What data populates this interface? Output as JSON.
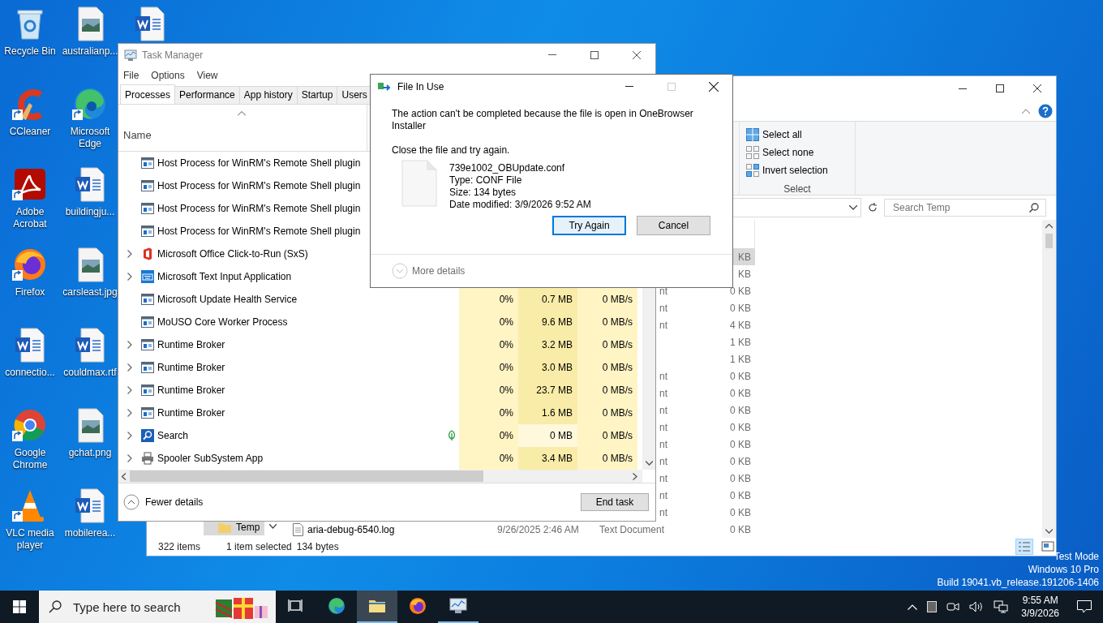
{
  "desktop": {
    "icons": [
      {
        "label": "Recycle Bin",
        "kind": "recycle",
        "shortcut": false
      },
      {
        "label": "CCleaner",
        "kind": "ccleaner",
        "shortcut": true
      },
      {
        "label": "Adobe Acrobat",
        "kind": "acrobat",
        "shortcut": true
      },
      {
        "label": "Firefox",
        "kind": "firefox",
        "shortcut": true
      },
      {
        "label": "connectio...",
        "kind": "word",
        "shortcut": false
      },
      {
        "label": "Google Chrome",
        "kind": "chrome",
        "shortcut": true
      },
      {
        "label": "VLC media player",
        "kind": "vlc",
        "shortcut": true
      },
      {
        "label": "australianp...",
        "kind": "image",
        "shortcut": false
      },
      {
        "label": "Microsoft Edge",
        "kind": "edge",
        "shortcut": true
      },
      {
        "label": "buildingju...",
        "kind": "word",
        "shortcut": false
      },
      {
        "label": "carsleast.jpg",
        "kind": "image",
        "shortcut": false
      },
      {
        "label": "couldmax.rtf",
        "kind": "word",
        "shortcut": false
      },
      {
        "label": "gchat.png",
        "kind": "image",
        "shortcut": false
      },
      {
        "label": "mobilerea...",
        "kind": "word",
        "shortcut": false
      },
      {
        "kind": "word",
        "shortcut": false
      }
    ]
  },
  "watermark": [
    "Test Mode",
    "Windows 10 Pro",
    "Build 19041.vb_release.191206-1406"
  ],
  "explorer": {
    "select_items": [
      {
        "label": "Select all",
        "kind": "all"
      },
      {
        "label": "Select none",
        "kind": "none"
      },
      {
        "label": "Invert selection",
        "kind": "invert"
      }
    ],
    "group_label": "Select",
    "search": {
      "placeholder": "Search Temp"
    },
    "nav_item": {
      "label": "Temp",
      "selected": true
    },
    "rows": [
      {
        "size": "KB",
        "selected": true
      },
      {
        "size": "KB",
        "selected": false
      },
      {
        "type": "nt",
        "size": "0 KB",
        "selected": false
      },
      {
        "type": "nt",
        "size": "0 KB",
        "selected": false
      },
      {
        "type": "nt",
        "size": "4 KB",
        "selected": false
      },
      {
        "size": "1 KB",
        "selected": false
      },
      {
        "size": "1 KB",
        "selected": false
      },
      {
        "type": "nt",
        "size": "0 KB",
        "selected": false
      },
      {
        "type": "nt",
        "size": "0 KB",
        "selected": false
      },
      {
        "type": "nt",
        "size": "0 KB",
        "selected": false
      },
      {
        "type": "nt",
        "size": "0 KB",
        "selected": false
      },
      {
        "type": "nt",
        "size": "0 KB",
        "selected": false
      },
      {
        "type": "nt",
        "size": "0 KB",
        "selected": false
      },
      {
        "type": "nt",
        "size": "0 KB",
        "selected": false
      },
      {
        "type": "nt",
        "size": "0 KB",
        "selected": false
      },
      {
        "type": "nt",
        "size": "0 KB",
        "selected": false
      },
      {
        "name": "aria-debug-6540.log",
        "date": "9/26/2025 2:46 AM",
        "type": "Text Document",
        "size": "0 KB",
        "selected": false
      }
    ],
    "status": {
      "count": "322 items",
      "selection": "1 item selected",
      "size": "134 bytes"
    }
  },
  "task_manager": {
    "title": "Task Manager",
    "menu": [
      "File",
      "Options",
      "View"
    ],
    "tabs": [
      {
        "label": "Processes",
        "selected": true
      },
      {
        "label": "Performance",
        "selected": false
      },
      {
        "label": "App history",
        "selected": false
      },
      {
        "label": "Startup",
        "selected": false
      },
      {
        "label": "Users",
        "selected": false
      }
    ],
    "column_name": "Name",
    "processes": [
      {
        "name": "Host Process for WinRM's Remote Shell plugin",
        "kind": "window",
        "expandable": false
      },
      {
        "name": "Host Process for WinRM's Remote Shell plugin",
        "kind": "window",
        "expandable": false
      },
      {
        "name": "Host Process for WinRM's Remote Shell plugin",
        "kind": "window",
        "expandable": false
      },
      {
        "name": "Host Process for WinRM's Remote Shell plugin",
        "kind": "window",
        "expandable": false
      },
      {
        "name": "Microsoft Office Click-to-Run (SxS)",
        "kind": "office",
        "expandable": true
      },
      {
        "name": "Microsoft Text Input Application",
        "kind": "keyboard",
        "expandable": true
      },
      {
        "name": "Microsoft Update Health Service",
        "kind": "window",
        "expandable": false,
        "eco": false,
        "cpu": "0%",
        "memory": "0.7 MB",
        "memory_highlighted": true,
        "disk": "0 MB/s"
      },
      {
        "name": "MoUSO Core Worker Process",
        "kind": "window",
        "expandable": false,
        "eco": false,
        "cpu": "0%",
        "memory": "9.6 MB",
        "memory_highlighted": true,
        "disk": "0 MB/s"
      },
      {
        "name": "Runtime Broker",
        "kind": "window",
        "expandable": true,
        "eco": false,
        "cpu": "0%",
        "memory": "3.2 MB",
        "memory_highlighted": true,
        "disk": "0 MB/s"
      },
      {
        "name": "Runtime Broker",
        "kind": "window",
        "expandable": true,
        "eco": false,
        "cpu": "0%",
        "memory": "3.0 MB",
        "memory_highlighted": true,
        "disk": "0 MB/s"
      },
      {
        "name": "Runtime Broker",
        "kind": "window",
        "expandable": true,
        "eco": false,
        "cpu": "0%",
        "memory": "23.7 MB",
        "memory_highlighted": true,
        "disk": "0 MB/s"
      },
      {
        "name": "Runtime Broker",
        "kind": "window",
        "expandable": true,
        "eco": false,
        "cpu": "0%",
        "memory": "1.6 MB",
        "memory_highlighted": true,
        "disk": "0 MB/s"
      },
      {
        "name": "Search",
        "kind": "search",
        "expandable": true,
        "eco": true,
        "cpu": "0%",
        "memory": "0 MB",
        "memory_highlighted": false,
        "disk": "0 MB/s"
      },
      {
        "name": "Spooler SubSystem App",
        "kind": "printer",
        "expandable": true,
        "eco": false,
        "cpu": "0%",
        "memory": "3.4 MB",
        "memory_highlighted": true,
        "disk": "0 MB/s"
      }
    ],
    "fewer_details": "Fewer details",
    "end_task": "End task"
  },
  "dialog": {
    "title": "File In Use",
    "maximize_disabled": true,
    "message": "The action can't be completed because the file is open in OneBrowser Installer",
    "instruction": "Close the file and try again.",
    "file": {
      "name": "739e1002_OBUpdate.conf",
      "lines": [
        "Type: CONF File",
        "Size: 134 bytes",
        "Date modified: 3/9/2026 9:52 AM"
      ]
    },
    "buttons": [
      {
        "label": "Try Again",
        "focused": true
      },
      {
        "label": "Cancel",
        "focused": false
      }
    ],
    "more_details": "More details"
  },
  "taskbar": {
    "search_placeholder": "Type here to search",
    "apps": [
      {
        "kind": "task-view",
        "active": false,
        "running": false
      },
      {
        "kind": "edge",
        "active": false,
        "running": false
      },
      {
        "kind": "folder",
        "active": true,
        "running": true
      },
      {
        "kind": "firefox",
        "active": false,
        "running": false
      },
      {
        "kind": "task-manager",
        "active": false,
        "running": true
      }
    ],
    "time": "9:55 AM",
    "date": "3/9/2026"
  }
}
